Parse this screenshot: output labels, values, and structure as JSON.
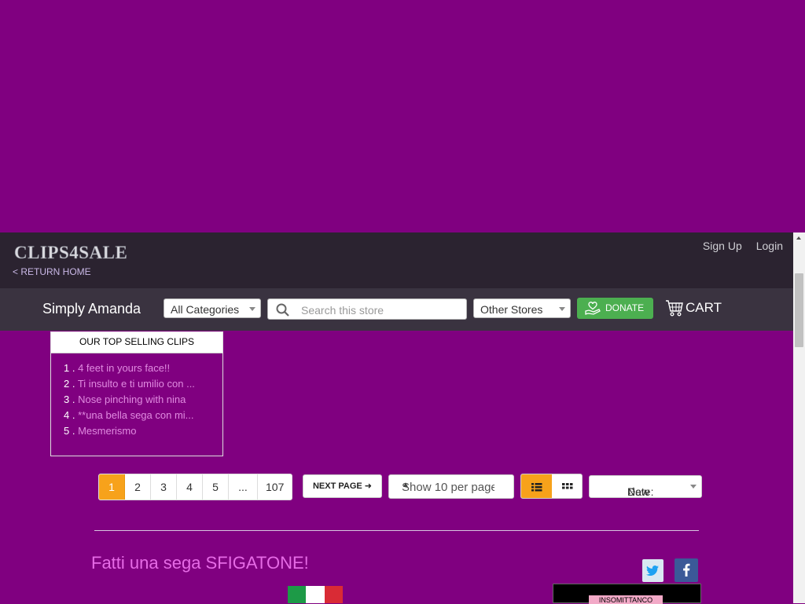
{
  "header": {
    "logo_text": "CLIPS4SALE",
    "return_home": "< RETURN HOME",
    "sign_up": "Sign Up",
    "login": "Login"
  },
  "storebar": {
    "store_name": "Simply Amanda",
    "categories_value": "All Categories",
    "search_placeholder": "Search this store",
    "other_stores_value": "Other Stores",
    "donate_label": "DONATE",
    "cart_label": "CART"
  },
  "top_clips": {
    "heading": "OUR TOP SELLING CLIPS",
    "items": [
      {
        "num": "1 . ",
        "title": "4 feet in yours face!!"
      },
      {
        "num": "2 . ",
        "title": "Ti insulto e ti umilio con ..."
      },
      {
        "num": "3 . ",
        "title": "Nose pinching with nina"
      },
      {
        "num": "4 . ",
        "title": "**una bella sega con mi..."
      },
      {
        "num": "5 . ",
        "title": "Mesmerismo"
      }
    ]
  },
  "toolbar": {
    "pages": [
      "1",
      "2",
      "3",
      "4",
      "5",
      "...",
      "107"
    ],
    "current_page": "1",
    "next_page": "NEXT PAGE",
    "per_page": "Show 10 per page",
    "sort_label": "Date:",
    "sort_value": "New"
  },
  "clip": {
    "title": "Fatti una sega SFIGATONE!",
    "thumb_text": "INSOMITTANCO"
  },
  "colors": {
    "page_bg": "#800080",
    "header_bg": "#2b2330",
    "storebar_bg": "#3a3340",
    "accent_orange": "#f7a21b",
    "donate_green": "#4caf50",
    "link_pink": "#e08be0",
    "title_pink": "#e66be6"
  },
  "icons": {
    "search": "search-icon",
    "donate": "donate-hand-heart-icon",
    "cart": "cart-icon",
    "list_view": "list-view-icon",
    "grid_view": "grid-view-icon",
    "twitter": "twitter-icon",
    "facebook": "facebook-icon",
    "flag": "italy-flag-icon"
  }
}
